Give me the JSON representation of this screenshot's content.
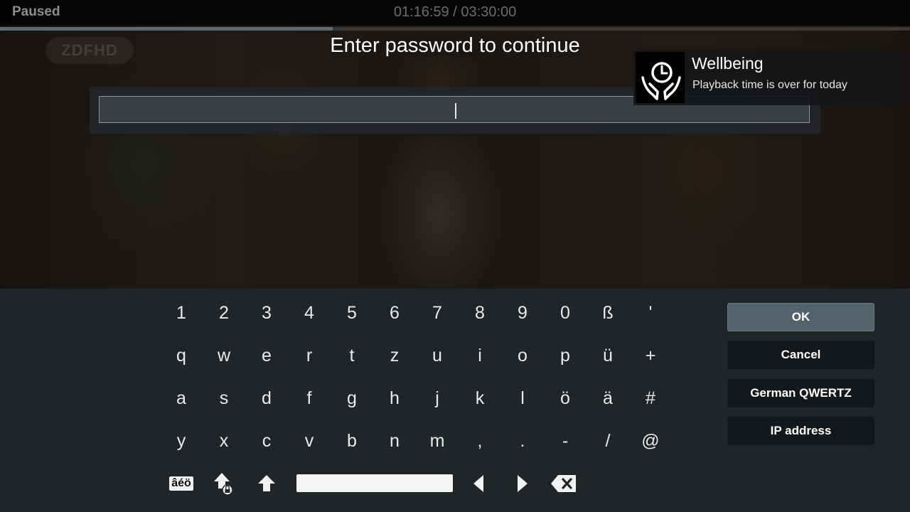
{
  "player": {
    "status": "Paused",
    "time": "01:16:59 / 03:30:00",
    "progress_fraction": 0.366
  },
  "video": {
    "channel_logo": "ZDFHD"
  },
  "dialog": {
    "title": "Enter password to continue",
    "input_value": ""
  },
  "notification": {
    "title": "Wellbeing",
    "message": "Playback time is over for today",
    "icon": "clock-hands-icon"
  },
  "keyboard": {
    "layout_name": "German QWERTZ",
    "rows": [
      [
        "1",
        "2",
        "3",
        "4",
        "5",
        "6",
        "7",
        "8",
        "9",
        "0",
        "ß",
        "'"
      ],
      [
        "q",
        "w",
        "e",
        "r",
        "t",
        "z",
        "u",
        "i",
        "o",
        "p",
        "ü",
        "+"
      ],
      [
        "a",
        "s",
        "d",
        "f",
        "g",
        "h",
        "j",
        "k",
        "l",
        "ö",
        "ä",
        "#"
      ],
      [
        "y",
        "x",
        "c",
        "v",
        "b",
        "n",
        "m",
        ",",
        ".",
        "-",
        "/",
        "@"
      ]
    ],
    "special_keys": {
      "symbols_label": "âéö",
      "capslock_icon": "capslock-icon",
      "shift_icon": "shift-icon",
      "space_icon": "space-bar",
      "left_icon": "arrow-left-icon",
      "right_icon": "arrow-right-icon",
      "backspace_icon": "backspace-icon"
    },
    "buttons": {
      "ok": "OK",
      "cancel": "Cancel",
      "layout": "German QWERTZ",
      "ip": "IP address"
    },
    "colors": {
      "focused_button": "#54626c",
      "button": "#14181a",
      "panel": "#202528"
    }
  }
}
